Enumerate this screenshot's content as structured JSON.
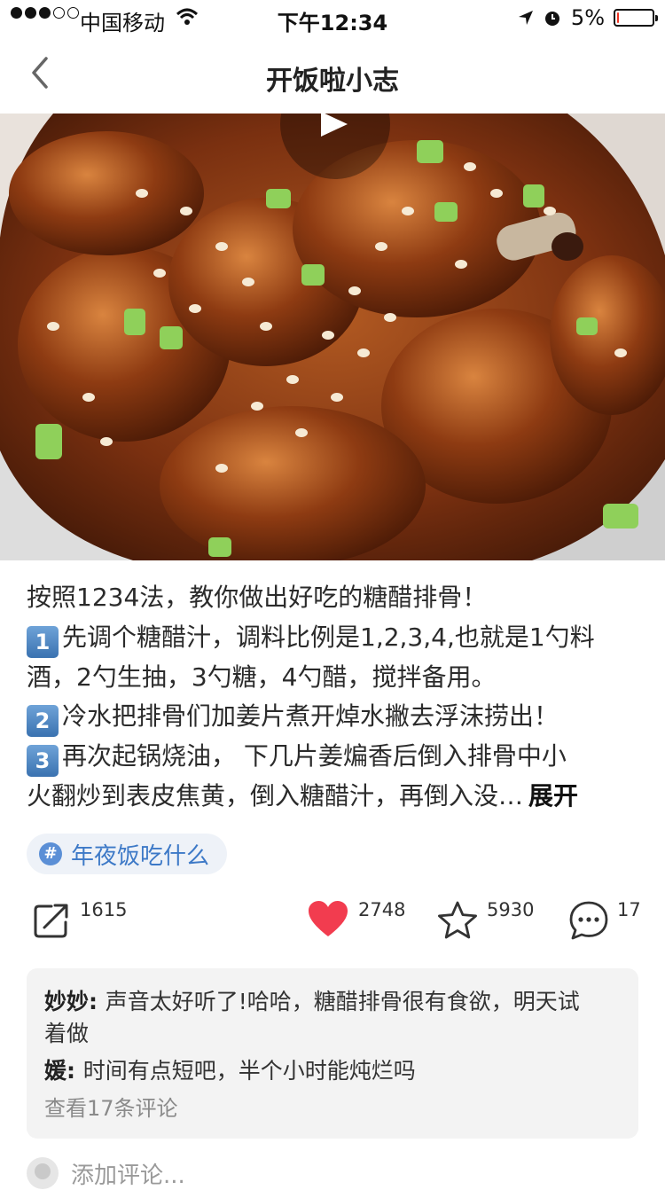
{
  "status_bar": {
    "carrier": "中国移动",
    "time": "下午12:34",
    "battery_text": "5%",
    "battery_level": 0.05
  },
  "nav": {
    "title": "开饭啦小志"
  },
  "post": {
    "lines": [
      {
        "num": "",
        "text": "按照1234法，教你做出好吃的糖醋排骨！"
      },
      {
        "num": "1",
        "text": "先调个糖醋汁，调料比例是1,2,3,4,也就是1勺料"
      },
      {
        "num": "",
        "text": "酒，2勺生抽，3勺糖，4勺醋，搅拌备用。"
      },
      {
        "num": "2",
        "text": "冷水把排骨们加姜片煮开焯水撇去浮沫捞出！"
      },
      {
        "num": "3",
        "text": "再次起锅烧油， 下几片姜煸香后倒入排骨中小"
      },
      {
        "num": "",
        "text": "火翻炒到表皮焦黄，倒入糖醋汁，再倒入没…"
      }
    ],
    "expand_label": "展开",
    "topic_tag": "年夜饭吃什么"
  },
  "actions": {
    "share_count": "1615",
    "like_count": "2748",
    "favorite_count": "5930",
    "comment_count": "17",
    "like_color": "#f23c4f"
  },
  "comments": {
    "items": [
      {
        "author": "妙妙",
        "text": "声音太好听了!哈哈，糖醋排骨很有食欲，明天试"
      },
      {
        "author": "",
        "text": "着做"
      },
      {
        "author": "媛",
        "text": "时间有点短吧，半个小时能炖烂吗"
      }
    ],
    "view_all_label": "查看17条评论",
    "add_placeholder": "添加评论..."
  }
}
